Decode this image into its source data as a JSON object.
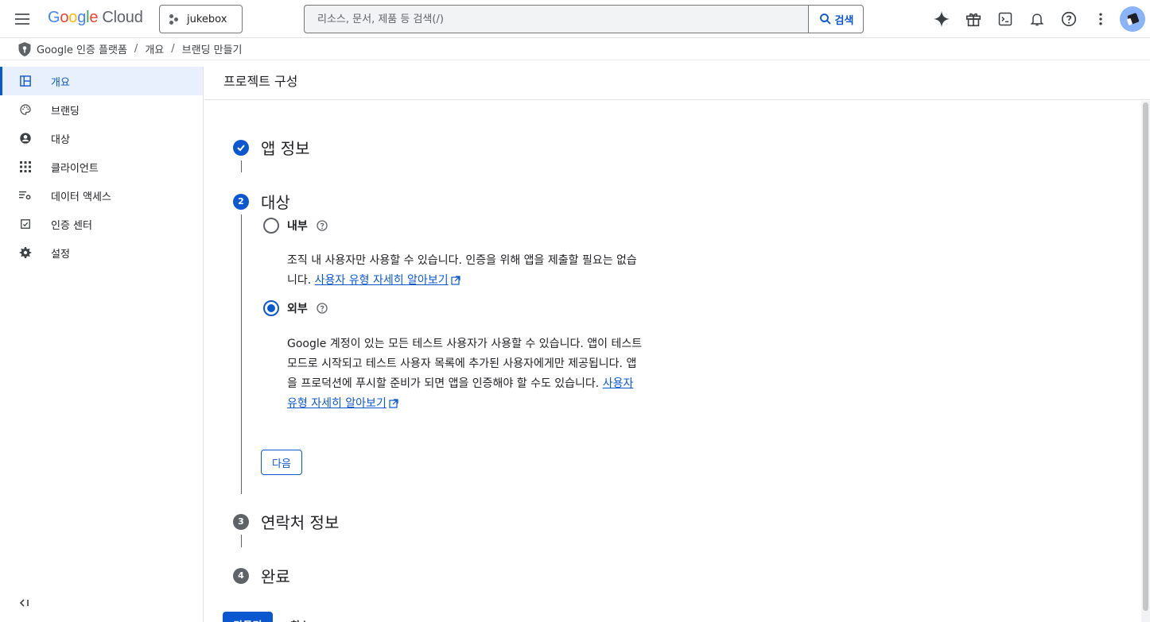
{
  "header": {
    "logo_letters": [
      "G",
      "o",
      "o",
      "g",
      "l",
      "e"
    ],
    "logo_cloud": "Cloud",
    "project_name": "jukebox",
    "search_placeholder": "리소스, 문서, 제품 등 검색(/)",
    "search_button": "검색",
    "icons": [
      "gemini-spark-icon",
      "gift-icon",
      "cloud-shell-icon",
      "notifications-icon",
      "help-icon",
      "more-vert-icon"
    ]
  },
  "breadcrumb": {
    "items": [
      "Google 인증 플랫폼",
      "개요",
      "브랜딩 만들기"
    ],
    "separator": "/"
  },
  "sidebar": {
    "items": [
      {
        "label": "개요",
        "icon": "dashboard-icon",
        "active": true
      },
      {
        "label": "브랜딩",
        "icon": "palette-icon",
        "active": false
      },
      {
        "label": "대상",
        "icon": "person-icon",
        "active": false
      },
      {
        "label": "클라이언트",
        "icon": "apps-grid-icon",
        "active": false
      },
      {
        "label": "데이터 액세스",
        "icon": "data-access-icon",
        "active": false
      },
      {
        "label": "인증 센터",
        "icon": "verified-icon",
        "active": false
      },
      {
        "label": "설정",
        "icon": "settings-icon",
        "active": false
      }
    ],
    "collapse_label": "<|"
  },
  "main": {
    "title": "프로젝트 구성",
    "steps": [
      {
        "number": "1",
        "title": "앱 정보",
        "status": "done"
      },
      {
        "number": "2",
        "title": "대상",
        "status": "current"
      },
      {
        "number": "3",
        "title": "연락처 정보",
        "status": "todo"
      },
      {
        "number": "4",
        "title": "완료",
        "status": "todo"
      }
    ],
    "audience": {
      "internal": {
        "label": "내부",
        "checked": false,
        "description": "조직 내 사용자만 사용할 수 있습니다. 인증을 위해 앱을 제출할 필요는 없습니다.",
        "link": "사용자 유형 자세히 알아보기"
      },
      "external": {
        "label": "외부",
        "checked": true,
        "description": "Google 계정이 있는 모든 테스트 사용자가 사용할 수 있습니다. 앱이 테스트 모드로 시작되고 테스트 사용자 목록에 추가된 사용자에게만 제공됩니다. 앱을 프로덕션에 푸시할 준비가 되면 앱을 인증해야 할 수도 있습니다.",
        "link": "사용자 유형 자세히 알아보기"
      }
    },
    "next_button": "다음",
    "create_button": "만들기",
    "cancel_button": "취소"
  },
  "colors": {
    "accent": "#0b57d0",
    "active_nav_bg": "#e8f0fe",
    "step_todo": "#5f6368"
  }
}
